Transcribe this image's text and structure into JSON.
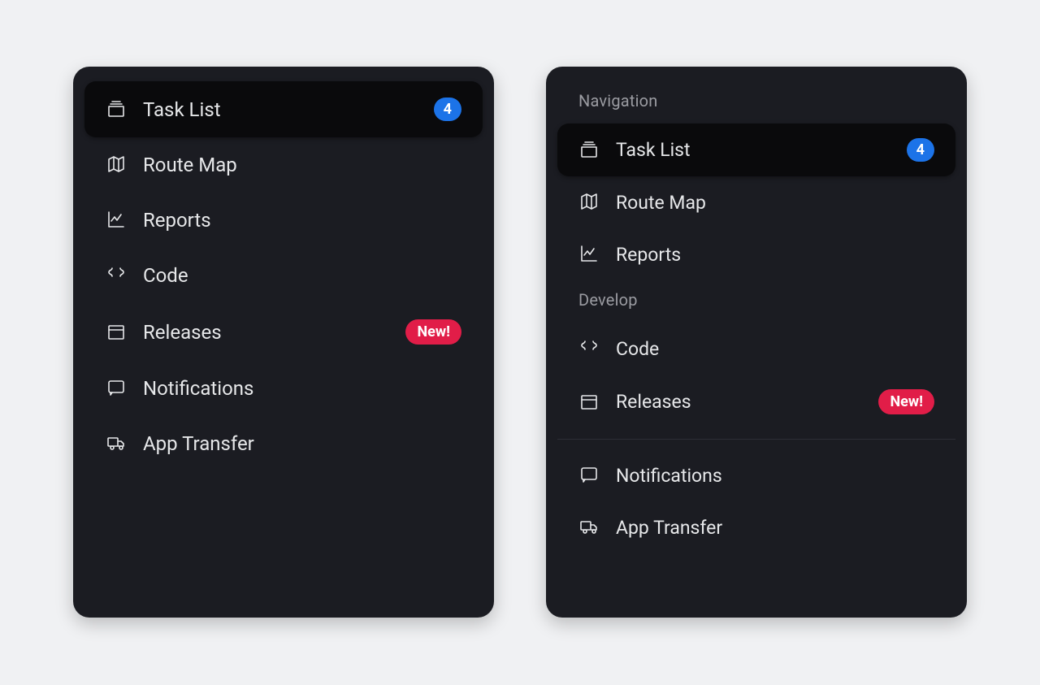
{
  "badges": {
    "task_count": "4",
    "new_label": "New!"
  },
  "labels": {
    "task_list": "Task List",
    "route_map": "Route Map",
    "reports": "Reports",
    "code": "Code",
    "releases": "Releases",
    "notifications": "Notifications",
    "app_transfer": "App Transfer"
  },
  "sections": {
    "navigation": "Navigation",
    "develop": "Develop"
  },
  "colors": {
    "badge_blue": "#1c73e8",
    "badge_red": "#e11d48",
    "card_bg": "#1b1c22",
    "active_bg": "#0a0a0c"
  }
}
